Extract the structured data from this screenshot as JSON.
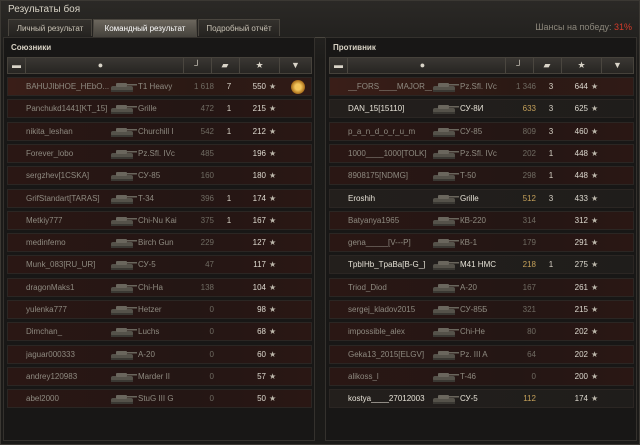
{
  "window": {
    "title": "Результаты боя"
  },
  "tabs": [
    {
      "label": "Личный результат",
      "active": false
    },
    {
      "label": "Командный результат",
      "active": true
    },
    {
      "label": "Подробный отчёт",
      "active": false
    }
  ],
  "chance": {
    "label": "Шансы на победу:",
    "value": "31%"
  },
  "allies": {
    "title": "Союзники",
    "rows": [
      {
        "player": "BAHUJIbHOE_HEbO...",
        "tank": "T1 Heavy",
        "damage": "1 618",
        "frags": "7",
        "xp": "550",
        "alive": false,
        "medal": true,
        "first": true
      },
      {
        "player": "Panchukd1441[KT_15]",
        "tank": "Grille",
        "damage": "472",
        "frags": "1",
        "xp": "215",
        "alive": false
      },
      {
        "player": "nikita_leshan",
        "tank": "Churchill I",
        "damage": "542",
        "frags": "1",
        "xp": "212",
        "alive": false
      },
      {
        "player": "Forever_lobo",
        "tank": "Pz.Sfl. IVc",
        "damage": "485",
        "frags": "",
        "xp": "196",
        "alive": false
      },
      {
        "player": "sergzhev[1CSKA]",
        "tank": "СУ-85",
        "damage": "160",
        "frags": "",
        "xp": "180",
        "alive": false
      },
      {
        "player": "GrifStandart[TARAS]",
        "tank": "T-34",
        "damage": "396",
        "frags": "1",
        "xp": "174",
        "alive": false
      },
      {
        "player": "Metkiy777",
        "tank": "Chi-Nu Kai",
        "damage": "375",
        "frags": "1",
        "xp": "167",
        "alive": false
      },
      {
        "player": "medinfemo",
        "tank": "Birch Gun",
        "damage": "229",
        "frags": "",
        "xp": "127",
        "alive": false
      },
      {
        "player": "Munk_083[RU_UR]",
        "tank": "СУ-5",
        "damage": "47",
        "frags": "",
        "xp": "117",
        "alive": false
      },
      {
        "player": "dragonMaks1",
        "tank": "Chi-Ha",
        "damage": "138",
        "frags": "",
        "xp": "104",
        "alive": false
      },
      {
        "player": "yulenka777",
        "tank": "Hetzer",
        "damage": "0",
        "frags": "",
        "xp": "98",
        "alive": false
      },
      {
        "player": "Dimchan_",
        "tank": "Luchs",
        "damage": "0",
        "frags": "",
        "xp": "68",
        "alive": false
      },
      {
        "player": "jaguar000333",
        "tank": "A-20",
        "damage": "0",
        "frags": "",
        "xp": "60",
        "alive": false
      },
      {
        "player": "andrey120983",
        "tank": "Marder II",
        "damage": "0",
        "frags": "",
        "xp": "57",
        "alive": false
      },
      {
        "player": "abel2000",
        "tank": "StuG III G",
        "damage": "0",
        "frags": "",
        "xp": "50",
        "alive": false
      }
    ]
  },
  "enemies": {
    "title": "Противник",
    "rows": [
      {
        "player": "__FORS____MAJOR__",
        "tank": "Pz.Sfl. IVc",
        "damage": "1 346",
        "frags": "3",
        "xp": "644",
        "alive": false,
        "first": true
      },
      {
        "player": "DAN_15[15110]",
        "tank": "СУ-8И",
        "damage": "633",
        "frags": "3",
        "xp": "625",
        "alive": true
      },
      {
        "player": "p_a_n_d_o_r_u_m",
        "tank": "СУ-85",
        "damage": "809",
        "frags": "3",
        "xp": "460",
        "alive": false
      },
      {
        "player": "1000____1000[TOLK]",
        "tank": "Pz.Sfl. IVc",
        "damage": "202",
        "frags": "1",
        "xp": "448",
        "alive": false
      },
      {
        "player": "8908175[NDMG]",
        "tank": "T-50",
        "damage": "298",
        "frags": "1",
        "xp": "448",
        "alive": false
      },
      {
        "player": "Eroshih",
        "tank": "Grille",
        "damage": "512",
        "frags": "3",
        "xp": "433",
        "alive": true
      },
      {
        "player": "Batyanya1965",
        "tank": "КВ-220",
        "damage": "314",
        "frags": "",
        "xp": "312",
        "alive": false
      },
      {
        "player": "gena_____[V---P]",
        "tank": "КВ-1",
        "damage": "179",
        "frags": "",
        "xp": "291",
        "alive": false
      },
      {
        "player": "TpbIHb_TpaBa[B-G_]",
        "tank": "M41 HMC",
        "damage": "218",
        "frags": "1",
        "xp": "275",
        "alive": true
      },
      {
        "player": "Triod_Diod",
        "tank": "A-20",
        "damage": "167",
        "frags": "",
        "xp": "261",
        "alive": false
      },
      {
        "player": "sergej_kladov2015",
        "tank": "СУ-85Б",
        "damage": "321",
        "frags": "",
        "xp": "215",
        "alive": false
      },
      {
        "player": "impossible_alex",
        "tank": "Chi-He",
        "damage": "80",
        "frags": "",
        "xp": "202",
        "alive": false
      },
      {
        "player": "Geka13_2015[ELGV]",
        "tank": "Pz. III A",
        "damage": "64",
        "frags": "",
        "xp": "202",
        "alive": false
      },
      {
        "player": "alikoss_l",
        "tank": "T-46",
        "damage": "0",
        "frags": "",
        "xp": "200",
        "alive": false
      },
      {
        "player": "kostya____27012003",
        "tank": "СУ-5",
        "damage": "112",
        "frags": "",
        "xp": "174",
        "alive": true
      }
    ]
  }
}
